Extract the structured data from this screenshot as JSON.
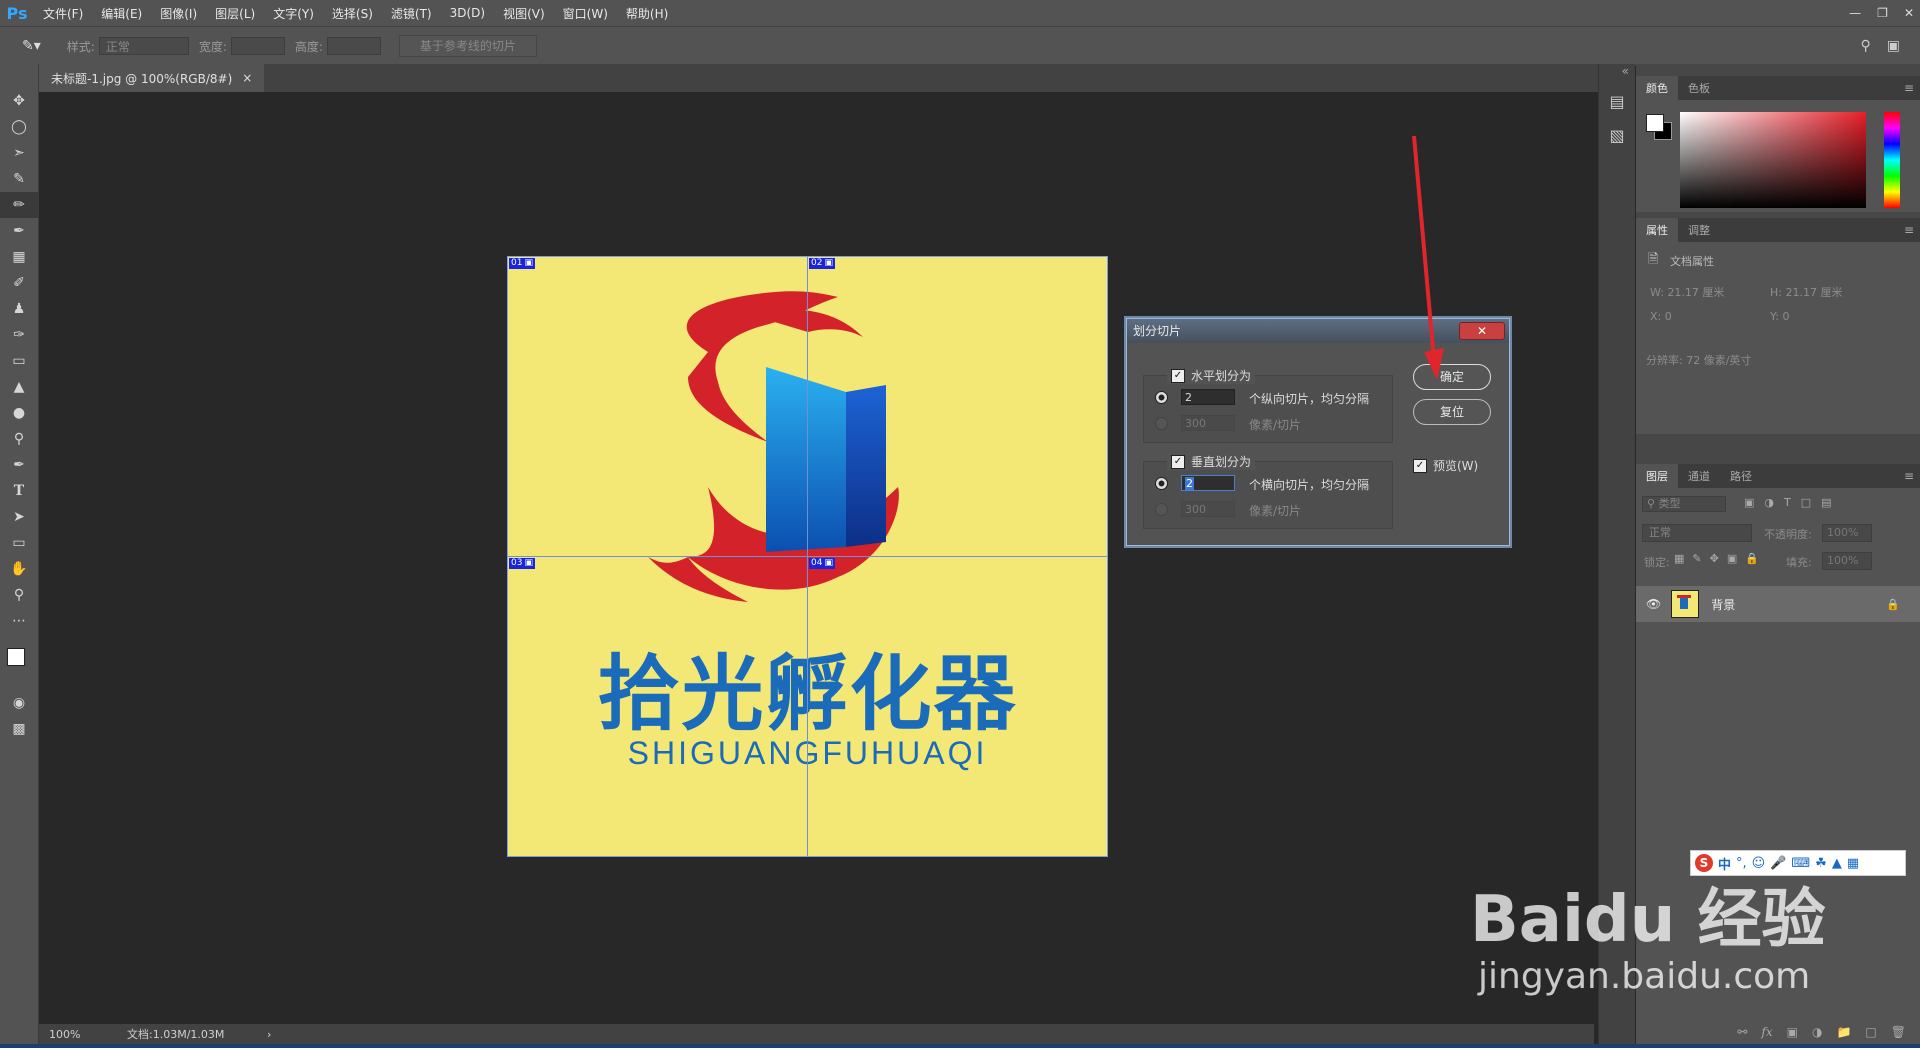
{
  "app": {
    "logo": "Ps"
  },
  "menu": [
    "文件(F)",
    "编辑(E)",
    "图像(I)",
    "图层(L)",
    "文字(Y)",
    "选择(S)",
    "滤镜(T)",
    "3D(D)",
    "视图(V)",
    "窗口(W)",
    "帮助(H)"
  ],
  "options": {
    "style_label": "样式:",
    "style_value": "正常",
    "width_label": "宽度:",
    "height_label": "高度:",
    "guides_button": "基于参考线的切片"
  },
  "document": {
    "tab_title": "未标题-1.jpg @ 100%(RGB/8#)",
    "close": "×"
  },
  "status": {
    "zoom": "100%",
    "doc_info": "文档:1.03M/1.03M",
    "arrow": "›"
  },
  "canvas": {
    "brand_cn": "拾光孵化器",
    "brand_en": "SHIGUANGFUHUAQI",
    "slices": [
      "01",
      "02",
      "03",
      "04"
    ]
  },
  "dialog": {
    "title": "划分切片",
    "close": "✕",
    "horizontal": {
      "checkbox_label": "水平划分为",
      "count_value": "2",
      "count_label": "个纵向切片，均匀分隔",
      "pixels_value": "300",
      "pixels_label": "像素/切片"
    },
    "vertical": {
      "checkbox_label": "垂直划分为",
      "count_value": "2",
      "count_label": "个横向切片，均匀分隔",
      "pixels_value": "300",
      "pixels_label": "像素/切片"
    },
    "ok": "确定",
    "reset": "复位",
    "preview": "预览(W)"
  },
  "panels": {
    "color_tabs": [
      "颜色",
      "色板"
    ],
    "props_tabs": [
      "属性",
      "调整"
    ],
    "doc_props": "文档属性",
    "w": "W:  21.17 厘米",
    "h": "H:  21.17 厘米",
    "x": "X:  0",
    "y": "Y:  0",
    "resolution": "分辨率: 72 像素/英寸",
    "layer_tabs": [
      "图层",
      "通道",
      "路径"
    ],
    "kind": "类型",
    "blend": "正常",
    "opacity_label": "不透明度:",
    "opacity_value": "100%",
    "lock_label": "锁定:",
    "fill_label": "填充:",
    "fill_value": "100%",
    "layer_name": "背景"
  },
  "watermark": {
    "line1": "Baidu 经验",
    "line2": "jingyan.baidu.com"
  },
  "ime": {
    "label": "中"
  },
  "colors": {
    "accent": "#31a8ff",
    "canvas_yellow": "#f3e775",
    "brand_blue": "#1a6cbb",
    "dragon_red": "#d3222a",
    "slice_blue": "#1a23e0",
    "arrow_red": "#e0262b"
  }
}
